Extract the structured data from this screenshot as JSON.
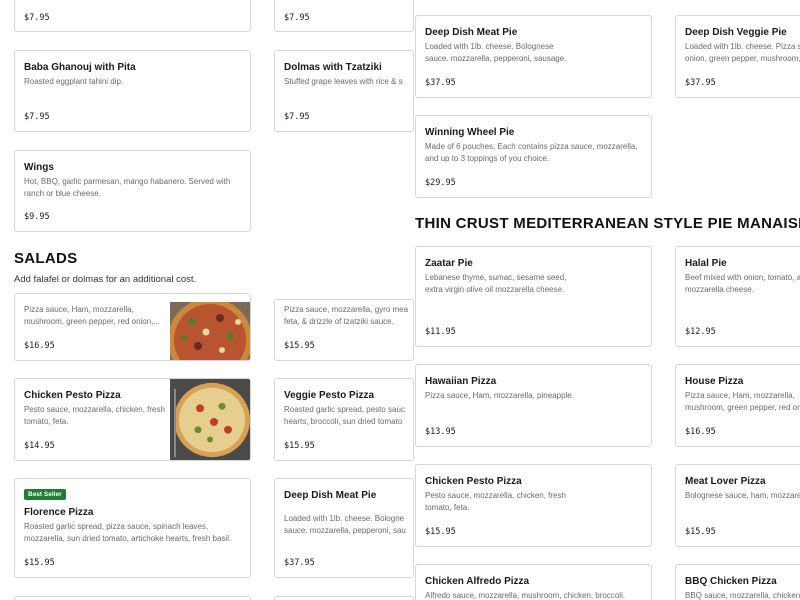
{
  "left_col": {
    "top_price_a": "$7.95",
    "top_price_b": "$7.95",
    "baba": {
      "name": "Baba Ghanouj with Pita",
      "desc": "Roasted eggplant tahini dip.",
      "price": "$7.95"
    },
    "dolmas": {
      "name": "Dolmas with Tzatziki",
      "desc": "Stuffed grape leaves with rice & s",
      "price": "$7.95"
    },
    "wings": {
      "name": "Wings",
      "desc1": "Hot, BBQ, garlic parmesan, mango habanero. Served with",
      "desc2": "ranch or blue cheese.",
      "price": "$9.95"
    },
    "salads": {
      "title": "SALADS",
      "note": "Add falafel or dolmas for an additional cost."
    },
    "house_pizza": {
      "desc1": "Pizza sauce, Ham, mozzarella,",
      "desc2": "mushroom, green pepper, red onion,...",
      "price": "$16.95"
    },
    "gyro_pizza": {
      "desc1": "Pizza sauce, mozzarella, gyro mea",
      "desc2": "feta, & drizzle of tzatziki sauce.",
      "price": "$15.95"
    },
    "chicken_pesto": {
      "name": "Chicken Pesto Pizza",
      "desc1": "Pesto sauce, mozzarella, chicken, fresh",
      "desc2": "tomato, feta.",
      "price": "$14.95"
    },
    "veggie_pesto": {
      "name": "Veggie Pesto Pizza",
      "desc1": "Roasted garlic spread, pesto sauc",
      "desc2": "hearts, broccoli, sun dried tomato",
      "price": "$15.95"
    },
    "florence": {
      "badge": "Best Seller",
      "name": "Florence Pizza",
      "desc1": "Roasted garlic spread, pizza sauce, spinach leaves,",
      "desc2": "mozzarella, sun dried tomato, artichoke hearts, fresh basil.",
      "price": "$15.95"
    },
    "deep_meat_left": {
      "name": "Deep Dish Meat Pie",
      "desc1": "Loaded with 1lb. cheese. Bologne",
      "desc2": "sauce. mozzarella, pepperoni, sau",
      "price": "$37.95"
    }
  },
  "right_col": {
    "deep_meat": {
      "name": "Deep Dish Meat Pie",
      "desc1": "Loaded with 1lb. cheese. Bolognese",
      "desc2": "sauce. mozzarella, pepperoni, sausage.",
      "price": "$37.95"
    },
    "deep_veggie": {
      "name": "Deep Dish Veggie Pie",
      "desc1": "Loaded with 1lb. cheese. Pizza sau",
      "desc2": "onion, green pepper, mushroom, o",
      "price": "$37.95"
    },
    "winning_wheel": {
      "name": "Winning Wheel Pie",
      "desc1": "Made of 6 pouches; Each contains pizza sauce, mozzarella,",
      "desc2": "and up to 3 toppings of you choice.",
      "price": "$29.95"
    },
    "thin_crust": {
      "title": "THIN CRUST MEDITERRANEAN STYLE PIE MANAISH"
    },
    "zaatar": {
      "name": "Zaatar Pie",
      "desc1": "Lebanese thyme, sumac, sesame seed,",
      "desc2": "extra virgin olive oil mozzarella cheese.",
      "price": "$11.95"
    },
    "halal": {
      "name": "Halal Pie",
      "desc1": "Beef mixed with onion, tomato, an",
      "desc2": "mozzarella cheese.",
      "price": "$12.95"
    },
    "hawaiian": {
      "name": "Hawaiian Pizza",
      "desc1": "Pizza sauce, Ham, mozzarella, pineapple.",
      "price": "$13.95"
    },
    "house": {
      "name": "House Pizza",
      "desc1": "Pizza sauce, Ham, mozzarella,",
      "desc2": "mushroom, green pepper, red oni",
      "price": "$16.95"
    },
    "chicken_pesto": {
      "name": "Chicken Pesto Pizza",
      "desc1": "Pesto sauce, mozzarella, chicken, fresh",
      "desc2": "tomato, feta.",
      "price": "$15.95"
    },
    "meat_lover": {
      "name": "Meat Lover Pizza",
      "desc1": "Bolognese sauce, ham, mozzarell",
      "price": "$15.95"
    },
    "chicken_alfredo": {
      "name": "Chicken Alfredo Pizza",
      "desc1": "Alfredo sauce, mozzarella, mushroom, chicken, broccoli."
    },
    "bbq_chicken": {
      "name": "BBQ Chicken Pizza",
      "desc1": "BBQ sauce, mozzarella, chicken,"
    }
  }
}
